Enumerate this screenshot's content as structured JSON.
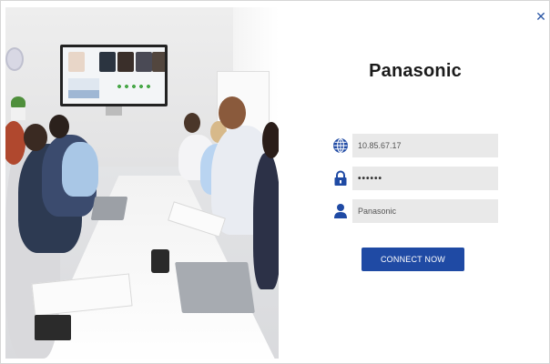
{
  "dialog": {
    "brand": "Panasonic",
    "close_icon": "close-icon",
    "fields": {
      "address": {
        "icon": "globe-icon",
        "value": "10.85.67.17"
      },
      "password": {
        "icon": "lock-icon",
        "value": "••••••"
      },
      "username": {
        "icon": "user-icon",
        "value": "Panasonic"
      }
    },
    "connect_label": "CONNECT NOW"
  },
  "colors": {
    "accent": "#1f4aa4",
    "field_bg": "#e9e9e9",
    "brand_text": "#1b1b1b"
  }
}
